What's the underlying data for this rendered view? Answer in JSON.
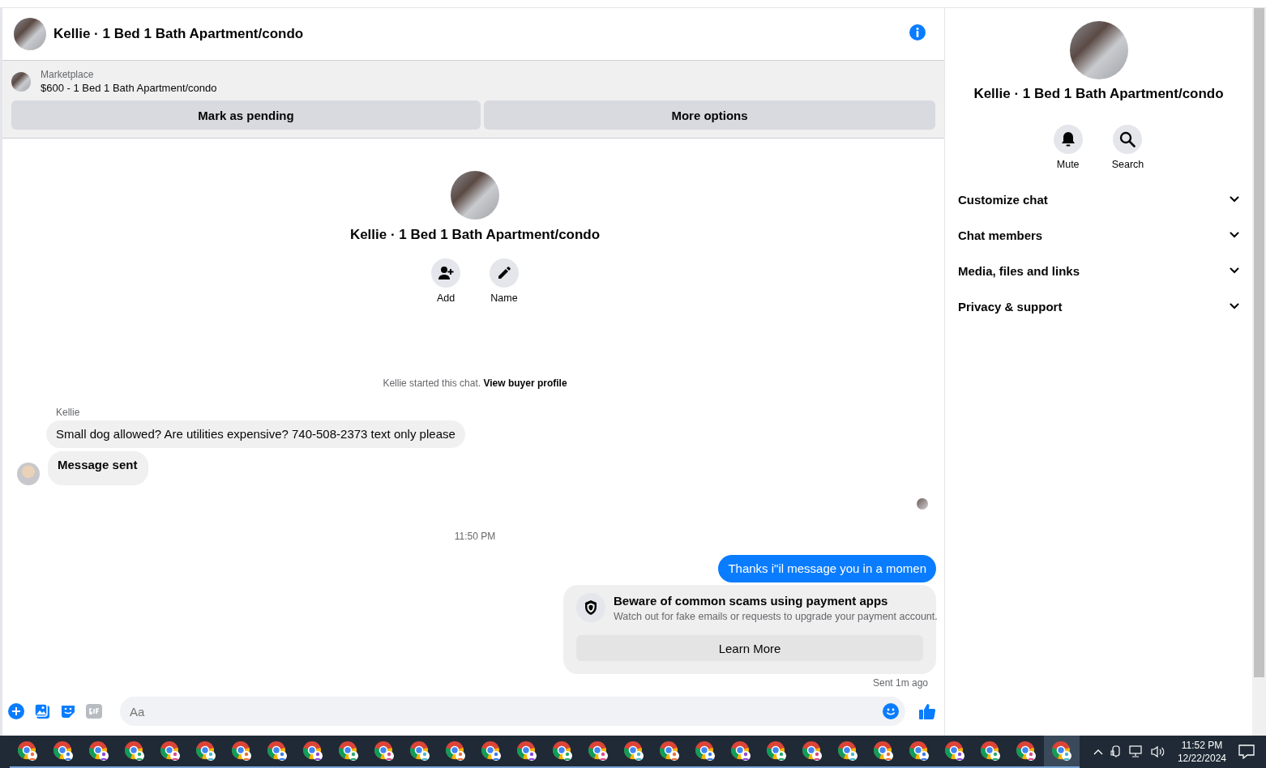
{
  "conversation": {
    "title": "Kellie · 1 Bed 1 Bath Apartment/condo"
  },
  "listing": {
    "source": "Marketplace",
    "summary": "$600 - 1 Bed 1 Bath Apartment/condo",
    "buttons": [
      "Mark as pending",
      "More options"
    ]
  },
  "intro": {
    "name": "Kellie · 1 Bed 1 Bath Apartment/condo",
    "actions": [
      {
        "kind": "add",
        "label": "Add"
      },
      {
        "kind": "name",
        "label": "Name"
      }
    ],
    "started_text": "Kellie started this chat.",
    "profile_link": "View buyer profile"
  },
  "messages": [
    {
      "kind": "incoming",
      "sender": "Kellie",
      "text": "Small dog allowed? Are utilities expensive? 740-508-2373 text only please"
    },
    {
      "kind": "incoming_bold",
      "text": "Message sent"
    },
    {
      "kind": "time",
      "text": "11:50 PM"
    },
    {
      "kind": "outgoing",
      "text": "Thanks i\"il message you in a momen"
    }
  ],
  "warning": {
    "title": "Beware of common scams using payment apps",
    "body": "Watch out for fake emails or requests to upgrade your payment account.",
    "button": "Learn More"
  },
  "sent_status": "Sent 1m ago",
  "composer": {
    "placeholder": "Aa"
  },
  "details_panel": {
    "name": "Kellie · 1 Bed 1 Bath Apartment/condo",
    "actions": [
      {
        "kind": "mute",
        "label": "Mute"
      },
      {
        "kind": "search",
        "label": "Search"
      }
    ],
    "sections": [
      {
        "label": "Customize chat",
        "expanded": false
      },
      {
        "label": "Chat members",
        "expanded": false
      },
      {
        "label": "Media, files and links",
        "expanded": false
      },
      {
        "label": "Privacy & support",
        "expanded": false
      }
    ]
  },
  "taskbar": {
    "apps": [
      {
        "selected": false
      },
      {
        "selected": false
      },
      {
        "selected": false
      },
      {
        "selected": false
      },
      {
        "selected": false
      },
      {
        "selected": false
      },
      {
        "selected": false
      },
      {
        "selected": false
      },
      {
        "selected": false
      },
      {
        "selected": false
      },
      {
        "selected": false
      },
      {
        "selected": false
      },
      {
        "selected": false
      },
      {
        "selected": false
      },
      {
        "selected": false
      },
      {
        "selected": false
      },
      {
        "selected": false
      },
      {
        "selected": false
      },
      {
        "selected": false
      },
      {
        "selected": false
      },
      {
        "selected": false
      },
      {
        "selected": false
      },
      {
        "selected": false
      },
      {
        "selected": false
      },
      {
        "selected": false
      },
      {
        "selected": false
      },
      {
        "selected": false
      },
      {
        "selected": false
      },
      {
        "selected": false
      },
      {
        "selected": true
      }
    ],
    "time": "11:52 PM",
    "date": "12/22/2024"
  }
}
